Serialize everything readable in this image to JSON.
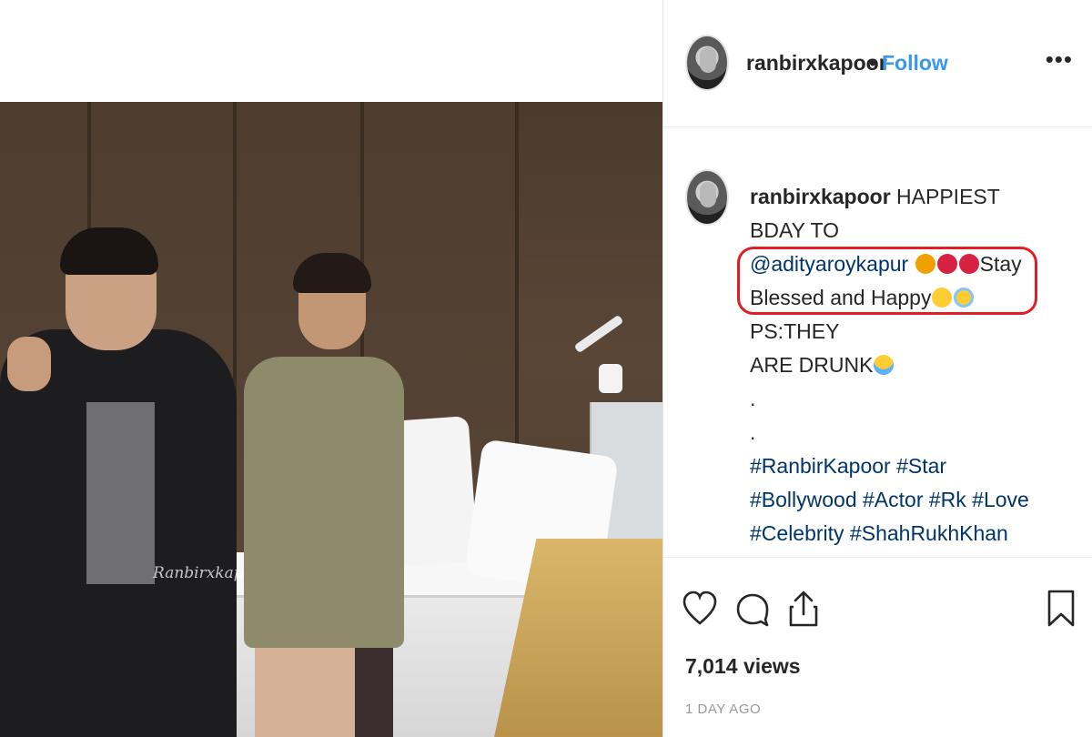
{
  "post": {
    "username": "ranbirxkapoor",
    "separator": "•",
    "follow_label": "Follow",
    "more_label": "•••",
    "media": {
      "watermark": "Ranbirxkap"
    },
    "caption": {
      "username": "ranbirxkapoor",
      "text_intro": "HAPPIEST BDAY TO",
      "mention": "@adityaroykapur",
      "text_stay": "Stay",
      "text_blessed": "Blessed and Happy",
      "text_ps": "PS:THEY",
      "text_drunk": "ARE DRUNK",
      "dot1": ".",
      "dot2": ".",
      "hashtags": "#RanbirKapoor #Star #Bollywood #Actor #Rk #Love #Celebrity #ShahRukhKhan #SalmanKhan #ShahidKapoor #VarunDhawan #TaimurAliKhan #KartikAaryan"
    },
    "views": "7,014 views",
    "timestamp": "1 DAY AGO"
  },
  "icons": [
    "profile-avatar",
    "more-options-icon",
    "party-popper-emoji",
    "heart-emoji",
    "heart-eyes-emoji",
    "halo-face-emoji",
    "laughing-tears-emoji",
    "like-heart-icon",
    "comment-icon",
    "share-icon",
    "bookmark-icon"
  ],
  "colors": {
    "link": "#3897f0",
    "hashtag": "#003569",
    "highlight": "#e01e26",
    "text": "#262626",
    "muted": "#999999"
  }
}
